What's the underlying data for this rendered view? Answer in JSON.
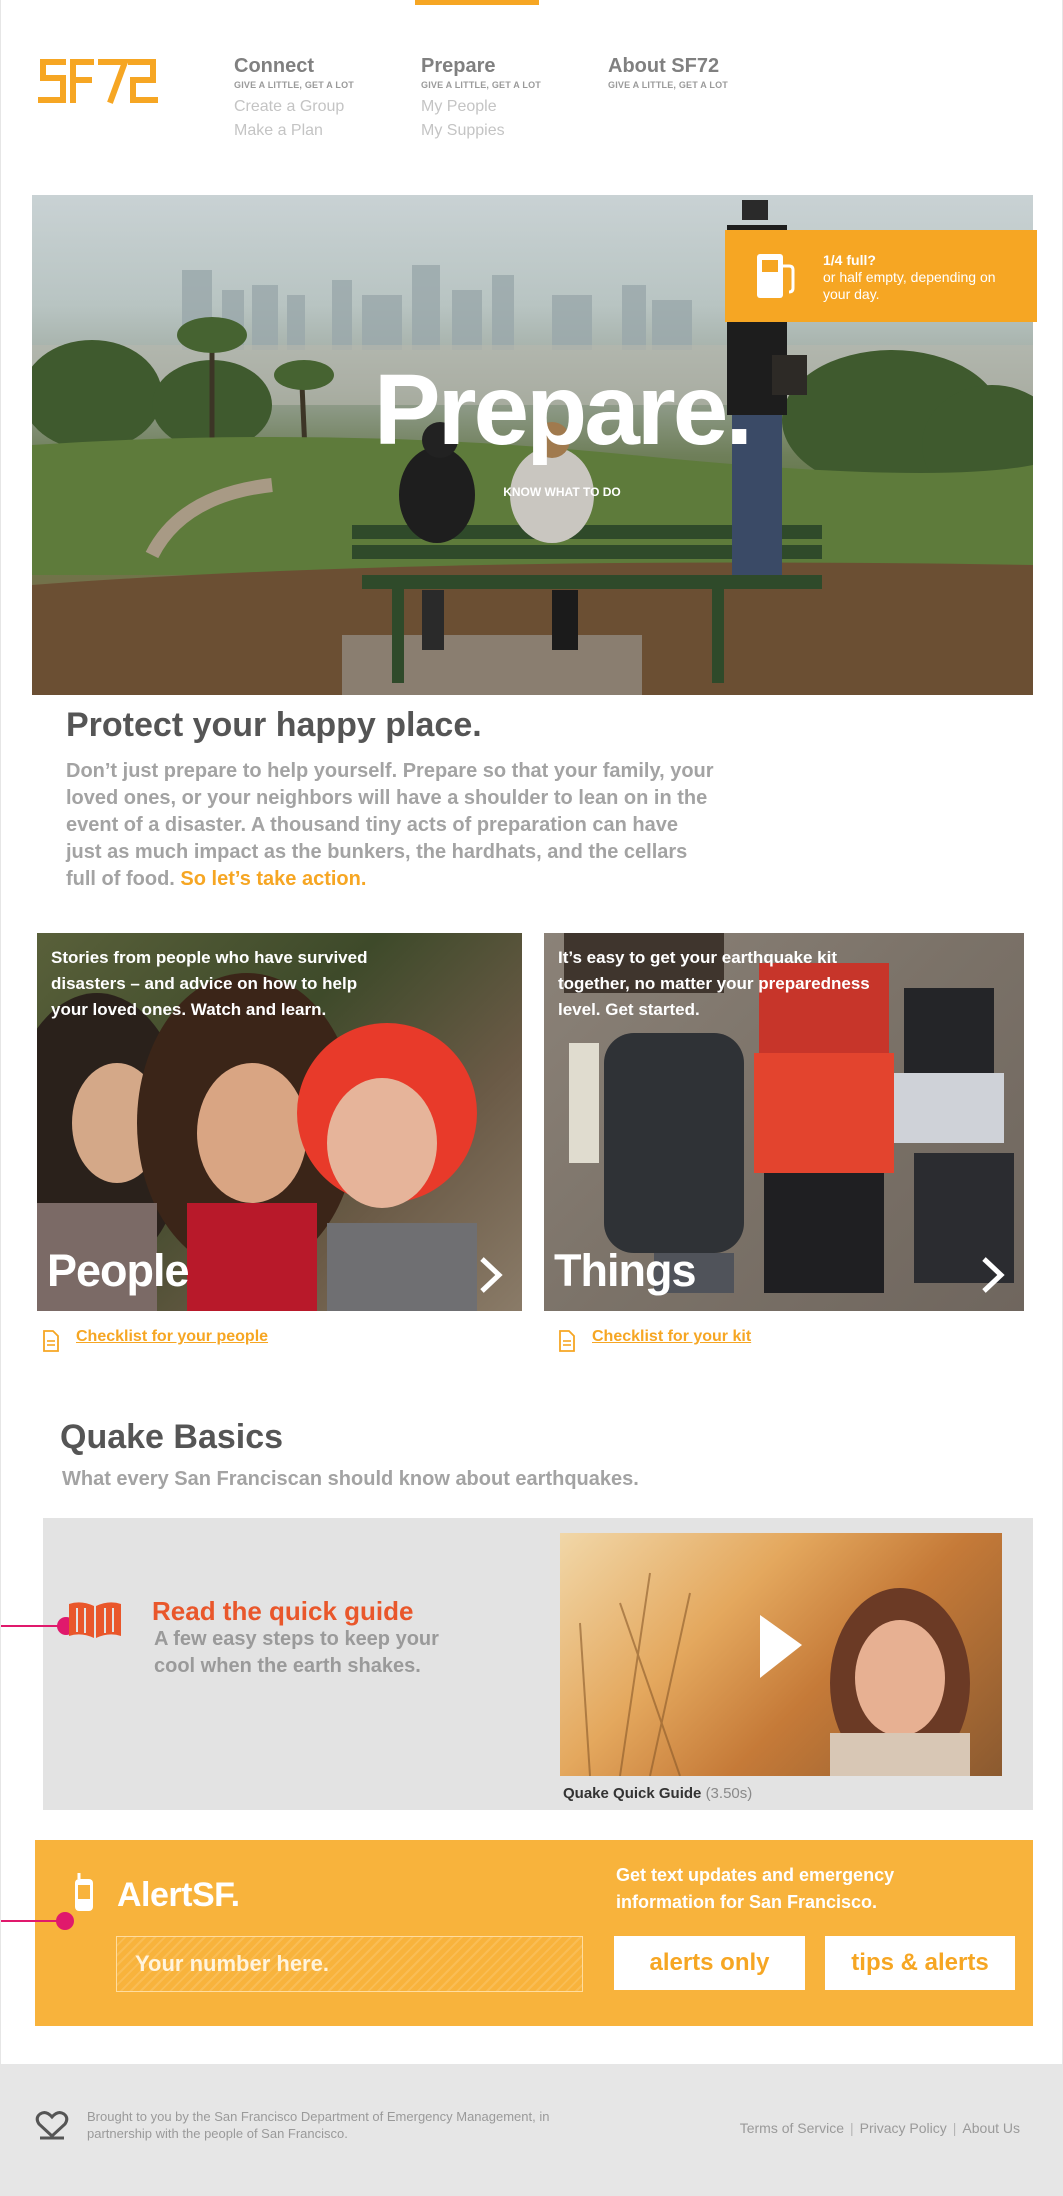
{
  "brand": {
    "logo_text": "SF72",
    "accent": "#f6a623",
    "alert_color": "#e9572b",
    "pin_color": "#e0196c"
  },
  "nav": {
    "connect": {
      "title": "Connect",
      "sub": "GIVE A LITTLE, GET A LOT",
      "links": [
        "Create a Group",
        "Make a Plan"
      ]
    },
    "prepare": {
      "title": "Prepare",
      "sub": "GIVE A LITTLE, GET A LOT",
      "links": [
        "My People",
        "My Suppies"
      ]
    },
    "about": {
      "title": "About SF72",
      "sub": "GIVE A LITTLE, GET A LOT"
    }
  },
  "hero": {
    "title": "Prepare.",
    "subtitle": "KNOW WHAT TO DO",
    "fuel": {
      "line1": "1/4 full?",
      "line2": "or half empty, depending on your day.",
      "icon": "fuel-pump-icon"
    }
  },
  "intro": {
    "title": "Protect your happy place.",
    "body": "Don’t just prepare to help yourself. Prepare so that your family, your loved ones, or your neighbors will have a shoulder to lean on in the event of a disaster. A thousand tiny acts of preparation can have just as much impact as the bunkers, the hardhats, and the cellars full of food.",
    "cta": "So let’s take action."
  },
  "cards": {
    "people": {
      "text": "Stories from people who have survived disasters – and advice on how to help your loved ones. Watch and learn.",
      "title": "People",
      "checklist": "Checklist for your people"
    },
    "things": {
      "text": "It’s easy to get your earthquake kit together, no matter your preparedness level. Get started.",
      "title": "Things",
      "checklist": "Checklist for your kit"
    }
  },
  "quake": {
    "title": "Quake Basics",
    "subtitle": "What every San Franciscan should know about earthquakes.",
    "guide_title": "Read the quick guide",
    "guide_body": "A few easy steps to keep your cool when the earth shakes.",
    "video_caption": "Quake Quick Guide",
    "video_duration": "(3.50s)"
  },
  "alert": {
    "title": "AlertSF.",
    "placeholder": "Your number here.",
    "description": "Get text updates and emergency information for San Francisco.",
    "button_alerts": "alerts only",
    "button_tips": "tips & alerts"
  },
  "footer": {
    "text": "Brought to you by the San Francisco Department of Emergency Management, in partnership with the people of San Francisco.",
    "links": [
      "Terms of Service",
      "Privacy Policy",
      "About Us"
    ]
  }
}
